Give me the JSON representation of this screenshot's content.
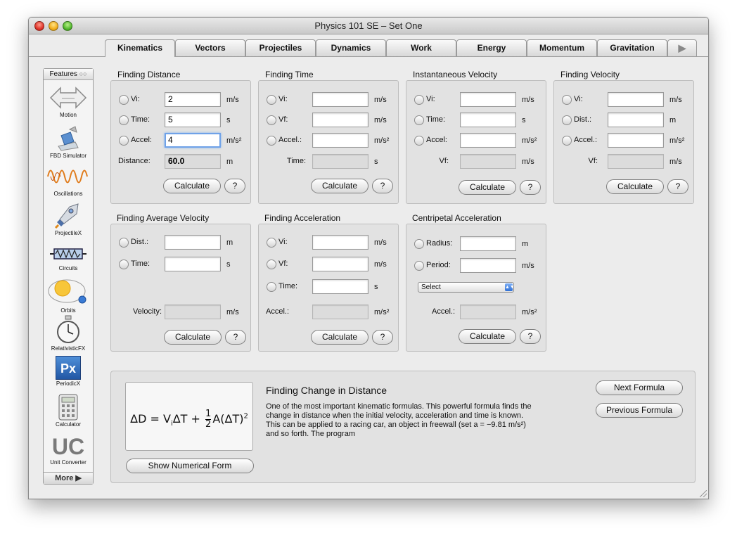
{
  "window": {
    "title": "Physics 101 SE – Set One"
  },
  "tabs": [
    "Kinematics",
    "Vectors",
    "Projectiles",
    "Dynamics",
    "Work",
    "Energy",
    "Momentum",
    "Gravitation"
  ],
  "tab_more": "▶",
  "sidebar": {
    "header": "Features",
    "header_icon": "○○",
    "footer": "More ▶",
    "items": [
      {
        "label": "Motion",
        "icon": "double-arrow-icon"
      },
      {
        "label": "FBD Simulator",
        "icon": "fbd-icon"
      },
      {
        "label": "Oscillations",
        "icon": "wave-icon"
      },
      {
        "label": "ProjectileX",
        "icon": "rocket-icon"
      },
      {
        "label": "Circuits",
        "icon": "resistor-icon"
      },
      {
        "label": "Orbits",
        "icon": "sun-orbit-icon"
      },
      {
        "label": "RelativisticFX",
        "icon": "stopwatch-icon"
      },
      {
        "label": "PeriodicX",
        "icon": "px-icon",
        "glyph": "Px"
      },
      {
        "label": "Calculator",
        "icon": "calculator-icon"
      },
      {
        "label": "Unit Converter",
        "icon": "uc-icon",
        "glyph": "UC"
      }
    ]
  },
  "common": {
    "calculate": "Calculate",
    "help": "?"
  },
  "groups": {
    "distance": {
      "title": "Finding Distance",
      "rows": [
        {
          "label": "Vi:",
          "value": "2",
          "unit": "m/s"
        },
        {
          "label": "Time:",
          "value": "5",
          "unit": "s"
        },
        {
          "label": "Accel:",
          "value": "4",
          "unit": "m/s²"
        }
      ],
      "result": {
        "label": "Distance:",
        "value": "60.0",
        "unit": "m"
      }
    },
    "time": {
      "title": "Finding Time",
      "rows": [
        {
          "label": "Vi:",
          "value": "",
          "unit": "m/s"
        },
        {
          "label": "Vf:",
          "value": "",
          "unit": "m/s"
        },
        {
          "label": "Accel.:",
          "value": "",
          "unit": "m/s²"
        }
      ],
      "result": {
        "label": "Time:",
        "value": "",
        "unit": "s"
      }
    },
    "inst_velocity": {
      "title": "Instantaneous Velocity",
      "rows": [
        {
          "label": "Vi:",
          "value": "",
          "unit": "m/s"
        },
        {
          "label": "Time:",
          "value": "",
          "unit": "s"
        },
        {
          "label": "Accel:",
          "value": "",
          "unit": "m/s²"
        }
      ],
      "result": {
        "label": "Vf:",
        "value": "",
        "unit": "m/s"
      }
    },
    "velocity": {
      "title": "Finding Velocity",
      "rows": [
        {
          "label": "Vi:",
          "value": "",
          "unit": "m/s"
        },
        {
          "label": "Dist.:",
          "value": "",
          "unit": "m"
        },
        {
          "label": "Accel.:",
          "value": "",
          "unit": "m/s²"
        }
      ],
      "result": {
        "label": "Vf:",
        "value": "",
        "unit": "m/s"
      }
    },
    "avg_velocity": {
      "title": "Finding Average Velocity",
      "rows": [
        {
          "label": "Dist.:",
          "value": "",
          "unit": "m"
        },
        {
          "label": "Time:",
          "value": "",
          "unit": "s"
        }
      ],
      "result": {
        "label": "Velocity:",
        "value": "",
        "unit": "m/s"
      }
    },
    "acceleration": {
      "title": "Finding Acceleration",
      "rows": [
        {
          "label": "Vi:",
          "value": "",
          "unit": "m/s"
        },
        {
          "label": "Vf:",
          "value": "",
          "unit": "m/s"
        },
        {
          "label": "Time:",
          "value": "",
          "unit": "s"
        }
      ],
      "result": {
        "label": "Accel.:",
        "value": "",
        "unit": "m/s²"
      }
    },
    "centripetal": {
      "title": "Centripetal Acceleration",
      "rows": [
        {
          "label": "Radius:",
          "value": "",
          "unit": "m"
        },
        {
          "label": "Period:",
          "value": "",
          "unit": "m/s"
        }
      ],
      "select": "Select",
      "result": {
        "label": "Accel.:",
        "value": "",
        "unit": "m/s²"
      }
    }
  },
  "info": {
    "title": "Finding Change in Distance",
    "text": "One of the most important kinematic formulas. This powerful formula finds the change in distance when the initial velocity, acceleration and time is known. This can be applied to a racing car, an object in freewall (set a = −9.81 m/s²) and so forth. The program",
    "formula": "ΔD = ViΔT + ½A(ΔT)²",
    "show_numerical": "Show Numerical Form",
    "next": "Next Formula",
    "previous": "Previous Formula"
  }
}
